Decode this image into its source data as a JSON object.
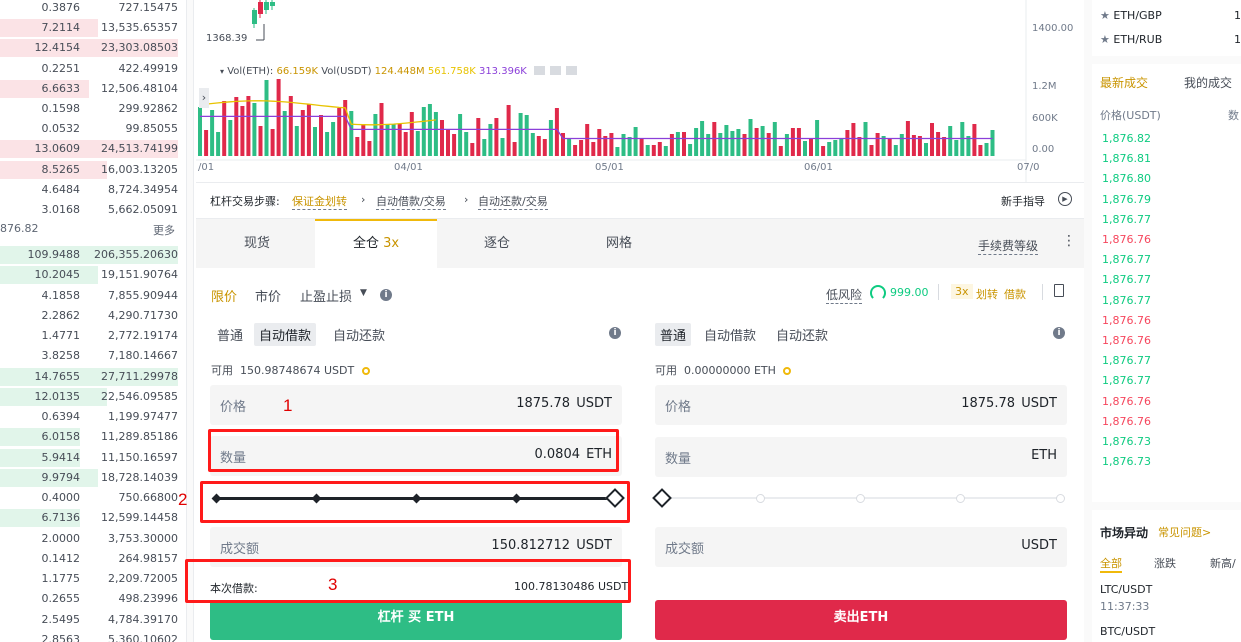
{
  "order_book": {
    "asks": [
      {
        "amount": "0.3876",
        "total": "727.15475"
      },
      {
        "amount": "7.2114",
        "total": "13,535.65357"
      },
      {
        "amount": "12.4154",
        "total": "23,303.08503"
      },
      {
        "amount": "0.2251",
        "total": "422.49919"
      },
      {
        "amount": "6.6633",
        "total": "12,506.48104"
      },
      {
        "amount": "0.1598",
        "total": "299.92862"
      },
      {
        "amount": "0.0532",
        "total": "99.85055"
      },
      {
        "amount": "13.0609",
        "total": "24,513.74199"
      },
      {
        "amount": "8.5265",
        "total": "16,003.13205"
      },
      {
        "amount": "4.6484",
        "total": "8,724.34954"
      },
      {
        "amount": "3.0168",
        "total": "5,662.05091"
      }
    ],
    "mid_price": "876.82",
    "more_label": "更多",
    "bids": [
      {
        "amount": "109.9488",
        "total": "206,355.20630"
      },
      {
        "amount": "10.2045",
        "total": "19,151.90764"
      },
      {
        "amount": "4.1858",
        "total": "7,855.90944"
      },
      {
        "amount": "2.2862",
        "total": "4,290.71730"
      },
      {
        "amount": "1.4771",
        "total": "2,772.19174"
      },
      {
        "amount": "3.8258",
        "total": "7,180.14667"
      },
      {
        "amount": "14.7655",
        "total": "27,711.29978"
      },
      {
        "amount": "12.0135",
        "total": "22,546.09585"
      },
      {
        "amount": "0.6394",
        "total": "1,199.97477"
      },
      {
        "amount": "6.0158",
        "total": "11,289.85186"
      },
      {
        "amount": "5.9414",
        "total": "11,150.16597"
      },
      {
        "amount": "9.9794",
        "total": "18,728.14039"
      },
      {
        "amount": "0.4000",
        "total": "750.66800"
      },
      {
        "amount": "6.7136",
        "total": "12,599.14458"
      },
      {
        "amount": "2.0000",
        "total": "3,753.30000"
      },
      {
        "amount": "0.1412",
        "total": "264.98157"
      },
      {
        "amount": "1.1775",
        "total": "2,209.72005"
      },
      {
        "amount": "0.2655",
        "total": "498.23996"
      },
      {
        "amount": "2.5495",
        "total": "4,784.39170"
      },
      {
        "amount": "2.8563",
        "total": "5,360.10602"
      }
    ]
  },
  "chart": {
    "low_label": "1368.39",
    "price_axis": [
      "1400.00"
    ],
    "vol_axis": [
      "1.2M",
      "600K",
      "0.00"
    ],
    "date_axis": [
      "/01",
      "04/01",
      "05/01",
      "06/01",
      "07/0"
    ],
    "legend": {
      "vol_eth_label": "Vol(ETH):",
      "vol_eth": "66.159K",
      "vol_usdt_label": "Vol(USDT)",
      "vol_usdt": "124.448M",
      "ma1": "561.758K",
      "ma2": "313.396K"
    },
    "expand_label": "›"
  },
  "steps": {
    "title": "杠杆交易步骤:",
    "step1": "保证金划转",
    "step2": "自动借款/交易",
    "step3": "自动还款/交易",
    "guide": "新手指导"
  },
  "mode_tabs": {
    "spot": "现货",
    "cross": "全仓",
    "cross_leverage": "3x",
    "isolated": "逐仓",
    "grid": "网格",
    "fee_level": "手续费等级"
  },
  "order_types": {
    "limit": "限价",
    "market": "市价",
    "stop": "止盈止损"
  },
  "risk": {
    "label": "低风险",
    "value": "999.00",
    "leverage": "3x",
    "transfer": "划转",
    "borrow": "借款"
  },
  "buy": {
    "tabs": [
      "普通",
      "自动借款",
      "自动还款"
    ],
    "available_label": "可用",
    "available": "150.98748674 USDT",
    "price_label": "价格",
    "price": "1875.78",
    "price_unit": "USDT",
    "qty_label": "数量",
    "qty": "0.0804",
    "qty_unit": "ETH",
    "total_label": "成交额",
    "total": "150.812712",
    "total_unit": "USDT",
    "loan_label": "本次借款:",
    "loan": "100.78130486 USDT",
    "button": "杠杆 买 ETH"
  },
  "sell": {
    "tabs": [
      "普通",
      "自动借款",
      "自动还款"
    ],
    "available_label": "可用",
    "available": "0.00000000 ETH",
    "price_label": "价格",
    "price": "1875.78",
    "price_unit": "USDT",
    "qty_label": "数量",
    "qty_unit": "ETH",
    "total_label": "成交额",
    "total_unit": "USDT",
    "button": "卖出ETH"
  },
  "annotations": [
    "1",
    "2",
    "3"
  ],
  "right_panel": {
    "pairs": [
      "ETH/GBP",
      "ETH/RUB"
    ],
    "pair_values": [
      "1",
      "1"
    ],
    "tab_latest": "最新成交",
    "tab_mine": "我的成交",
    "price_header": "价格(USDT)",
    "qty_header": "数",
    "trades": [
      {
        "price": "1,876.82",
        "dir": "up"
      },
      {
        "price": "1,876.81",
        "dir": "up"
      },
      {
        "price": "1,876.80",
        "dir": "up"
      },
      {
        "price": "1,876.79",
        "dir": "up"
      },
      {
        "price": "1,876.77",
        "dir": "up"
      },
      {
        "price": "1,876.76",
        "dir": "down"
      },
      {
        "price": "1,876.77",
        "dir": "up"
      },
      {
        "price": "1,876.77",
        "dir": "up"
      },
      {
        "price": "1,876.77",
        "dir": "up"
      },
      {
        "price": "1,876.76",
        "dir": "down"
      },
      {
        "price": "1,876.76",
        "dir": "down"
      },
      {
        "price": "1,876.77",
        "dir": "up"
      },
      {
        "price": "1,876.77",
        "dir": "up"
      },
      {
        "price": "1,876.76",
        "dir": "down"
      },
      {
        "price": "1,876.76",
        "dir": "down"
      },
      {
        "price": "1,876.73",
        "dir": "up"
      },
      {
        "price": "1,876.73",
        "dir": "up"
      }
    ],
    "market_title": "市场异动",
    "market_faq": "常见问题>",
    "market_tabs": [
      "全部",
      "涨跌",
      "新高/"
    ],
    "movers": [
      {
        "pair": "LTC/USDT",
        "time": "11:37:33"
      },
      {
        "pair": "BTC/USDT"
      }
    ]
  },
  "colors": {
    "buy_green": "#2ebd85",
    "sell_red": "#e0294a",
    "accent_yellow": "#f0b90b",
    "annotation_red": "#ff1a1a"
  }
}
